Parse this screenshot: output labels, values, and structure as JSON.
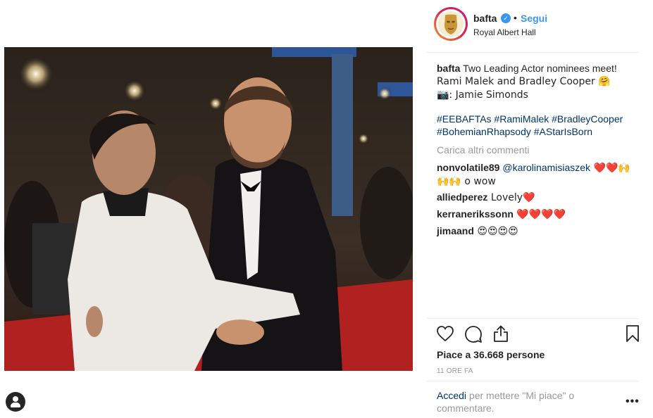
{
  "post": {
    "username": "bafta",
    "verified_mark": "✓",
    "separator": "•",
    "follow_label": "Segui",
    "location": "Royal Albert Hall"
  },
  "caption": {
    "username": "bafta",
    "text_line1": " Two Leading Actor nominees meet!",
    "text_line2": "Rami Malek and Bradley Cooper 🤗",
    "text_line3": "📷: Jamie Simonds",
    "hashtags_line1": "#EEBAFTAs #RamiMalek #BradleyCooper",
    "hashtags_line2": "#BohemianRhapsody #AStarIsBorn"
  },
  "load_more_label": "Carica altri commenti",
  "comments": [
    {
      "user": "nonvolatile89",
      "mention": "@karolinamisiaszek",
      "text_a": " ❤️❤️🙌",
      "text_b": "🙌🙌 o wow"
    },
    {
      "user": "alliedperez",
      "text": " Lovely❤️"
    },
    {
      "user": "kerranerikssonn",
      "text": " ❤️❤️❤️❤️"
    },
    {
      "user": "jimaand",
      "text": " 😍😍😍😍"
    }
  ],
  "actions": {
    "like_icon": "heart-icon",
    "comment_icon": "comment-icon",
    "share_icon": "share-icon",
    "save_icon": "bookmark-icon"
  },
  "likes_text": "Piace a 36.668 persone",
  "time_text": "11 ORE FA",
  "login": {
    "link": "Accedi",
    "rest": " per mettere \"Mi piace\" o commentare."
  },
  "more_label": "•••",
  "colors": {
    "link": "#3897f0",
    "hashtag": "#003569",
    "muted": "#999999",
    "carpet": "#b0211f"
  }
}
